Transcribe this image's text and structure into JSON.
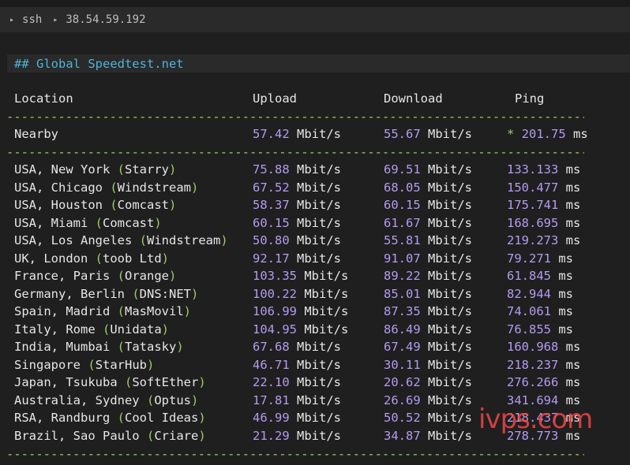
{
  "titlebar": {
    "segments": [
      "ssh",
      "38.54.59.192"
    ]
  },
  "section_title": "## Global Speedtest.net",
  "columns": {
    "location": "Location",
    "upload": "Upload",
    "download": "Download",
    "ping": "Ping"
  },
  "units": {
    "speed": "Mbit/s",
    "ping": "ms"
  },
  "nearby": {
    "location": "Nearby",
    "upload": "57.42",
    "download": "55.67",
    "ping_marker": "*",
    "ping": "201.75"
  },
  "rows": [
    {
      "place": "USA, New York",
      "provider": "Starry",
      "upload": "75.88",
      "download": "69.51",
      "ping": "133.133"
    },
    {
      "place": "USA, Chicago",
      "provider": "Windstream",
      "upload": "67.52",
      "download": "68.05",
      "ping": "150.477"
    },
    {
      "place": "USA, Houston",
      "provider": "Comcast",
      "upload": "58.37",
      "download": "60.15",
      "ping": "175.741"
    },
    {
      "place": "USA, Miami",
      "provider": "Comcast",
      "upload": "60.15",
      "download": "61.67",
      "ping": "168.695"
    },
    {
      "place": "USA, Los Angeles",
      "provider": "Windstream",
      "upload": "50.80",
      "download": "55.81",
      "ping": "219.273"
    },
    {
      "place": "UK, London",
      "provider": "toob Ltd",
      "upload": "92.17",
      "download": "91.07",
      "ping": "79.271"
    },
    {
      "place": "France, Paris",
      "provider": "Orange",
      "upload": "103.35",
      "download": "89.22",
      "ping": "61.845"
    },
    {
      "place": "Germany, Berlin",
      "provider": "DNS:NET",
      "upload": "100.22",
      "download": "85.01",
      "ping": "82.944"
    },
    {
      "place": "Spain, Madrid",
      "provider": "MasMovil",
      "upload": "106.99",
      "download": "87.35",
      "ping": "74.061"
    },
    {
      "place": "Italy, Rome",
      "provider": "Unidata",
      "upload": "104.95",
      "download": "86.49",
      "ping": "76.855"
    },
    {
      "place": "India, Mumbai",
      "provider": "Tatasky",
      "upload": "67.68",
      "download": "67.49",
      "ping": "160.968"
    },
    {
      "place": "Singapore",
      "provider": "StarHub",
      "upload": "46.71",
      "download": "30.11",
      "ping": "218.237"
    },
    {
      "place": "Japan, Tsukuba",
      "provider": "SoftEther",
      "upload": "22.10",
      "download": "20.62",
      "ping": "276.266"
    },
    {
      "place": "Australia, Sydney",
      "provider": "Optus",
      "upload": "17.81",
      "download": "26.69",
      "ping": "341.694"
    },
    {
      "place": "RSA, Randburg",
      "provider": "Cool Ideas",
      "upload": "46.99",
      "download": "50.52",
      "ping": "218.437"
    },
    {
      "place": "Brazil, Sao Paulo",
      "provider": "Criare",
      "upload": "21.29",
      "download": "34.87",
      "ping": "278.773"
    }
  ],
  "watermark": "ivps.com",
  "colors": {
    "accent": "#4fb3d9",
    "number": "#b49bf0",
    "separator": "#9ccc65",
    "background": "#1f1f1f"
  }
}
